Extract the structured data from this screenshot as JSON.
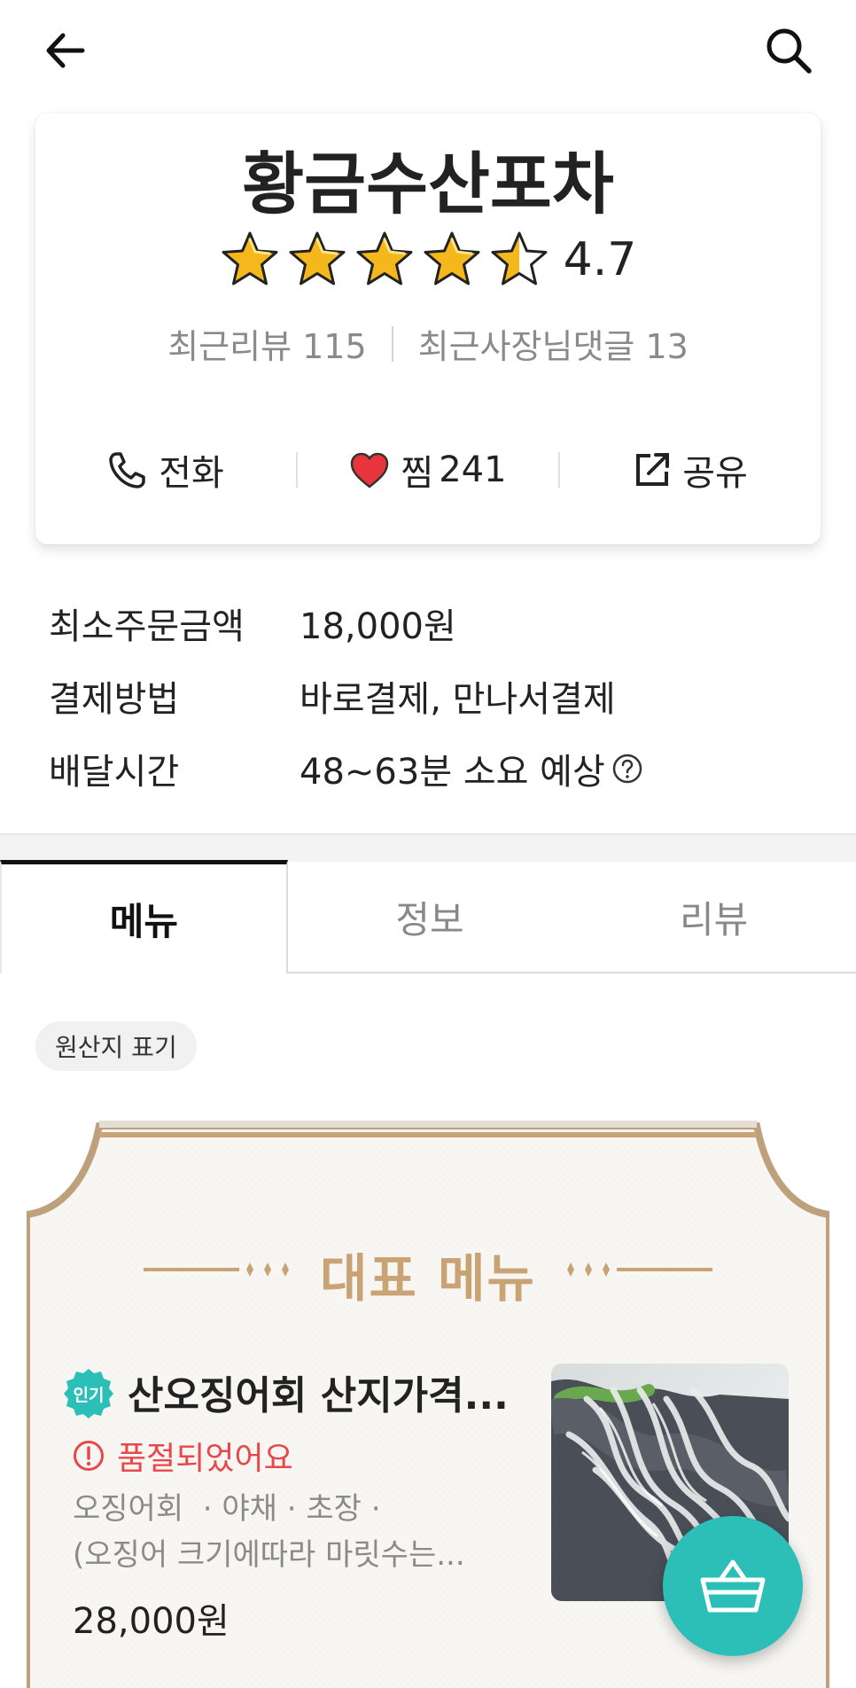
{
  "store": {
    "name": "황금수산포차",
    "rating": "4.7",
    "rating_value": 4.7,
    "recent_reviews": "최근리뷰 115",
    "owner_comments": "최근사장님댓글 13"
  },
  "actions": {
    "call_label": "전화",
    "like_label": "찜",
    "like_count": "241",
    "share_label": "공유"
  },
  "info": {
    "rows": [
      {
        "label": "최소주문금액",
        "value": "18,000원"
      },
      {
        "label": "결제방법",
        "value": "바로결제, 만나서결제"
      },
      {
        "label": "배달시간",
        "value": "48~63분 소요 예상"
      }
    ]
  },
  "tabs": [
    {
      "label": "메뉴",
      "active": true
    },
    {
      "label": "정보",
      "active": false
    },
    {
      "label": "리뷰",
      "active": false
    }
  ],
  "origin_chip": "원산지 표기",
  "featured": {
    "title": "대표 메뉴",
    "item": {
      "badge": "인기",
      "name": "산오징어회 산지가격...",
      "soldout": "품절되었어요",
      "desc_line1": "오징어회  · 야채 · 초장 ·",
      "desc_line2": "(오징어 크기에따라 마릿수는...",
      "price": "28,000원"
    }
  },
  "colors": {
    "accent_teal": "#2bbfb8",
    "gold": "#c9a374",
    "soldout_red": "#e8484b",
    "star_yellow": "#f5b81c"
  },
  "icons": [
    "back-arrow-icon",
    "search-icon",
    "star-icon",
    "phone-icon",
    "heart-icon",
    "share-icon",
    "question-icon",
    "alert-icon",
    "basket-icon"
  ]
}
